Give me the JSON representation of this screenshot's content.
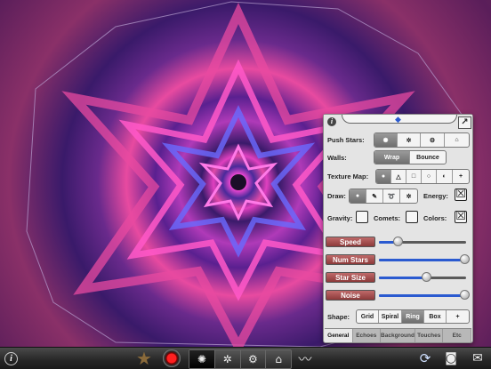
{
  "panel": {
    "info_icon": "info-icon",
    "expand_icon": "expand-arrow-icon",
    "push_stars": {
      "label": "Push Stars:",
      "options": [
        "✺",
        "✲",
        "⚙",
        "⌂"
      ],
      "selected_index": 0
    },
    "walls": {
      "label": "Walls:",
      "options": [
        "Wrap",
        "Bounce"
      ],
      "selected_index": 0
    },
    "texture_map": {
      "label": "Texture Map:",
      "options": [
        "●",
        "△",
        "□",
        "○",
        "◐",
        "+"
      ],
      "selected_index": 0
    },
    "draw": {
      "label": "Draw:",
      "options": [
        "●",
        "✎",
        "➰",
        "✲"
      ],
      "selected_index": 0
    },
    "energy": {
      "label": "Energy:",
      "checked": true,
      "mark": "☒"
    },
    "gravity": {
      "label": "Gravity:",
      "checked": false
    },
    "comets": {
      "label": "Comets:",
      "checked": false
    },
    "colors": {
      "label": "Colors:",
      "checked": true,
      "mark": "☒"
    },
    "sliders": [
      {
        "label": "Speed",
        "value": 0.22
      },
      {
        "label": "Num Stars",
        "value": 0.98
      },
      {
        "label": "Star Size",
        "value": 0.55
      },
      {
        "label": "Noise",
        "value": 0.98
      }
    ],
    "shape": {
      "label": "Shape:",
      "options": [
        "Grid",
        "Spiral",
        "Ring",
        "Box",
        "+"
      ],
      "selected_index": 2
    },
    "tabs": [
      "General",
      "Echoes",
      "Background",
      "Touches",
      "Etc"
    ],
    "selected_tab": 0
  },
  "toolbar": {
    "info": "i",
    "star": "★",
    "record_icon": "record-icon",
    "group": [
      "✺",
      "✲",
      "⚙",
      "⌂"
    ],
    "group_selected": 0,
    "wave": "〰",
    "sync": "⟳",
    "camera": "◙",
    "share": "✉"
  }
}
